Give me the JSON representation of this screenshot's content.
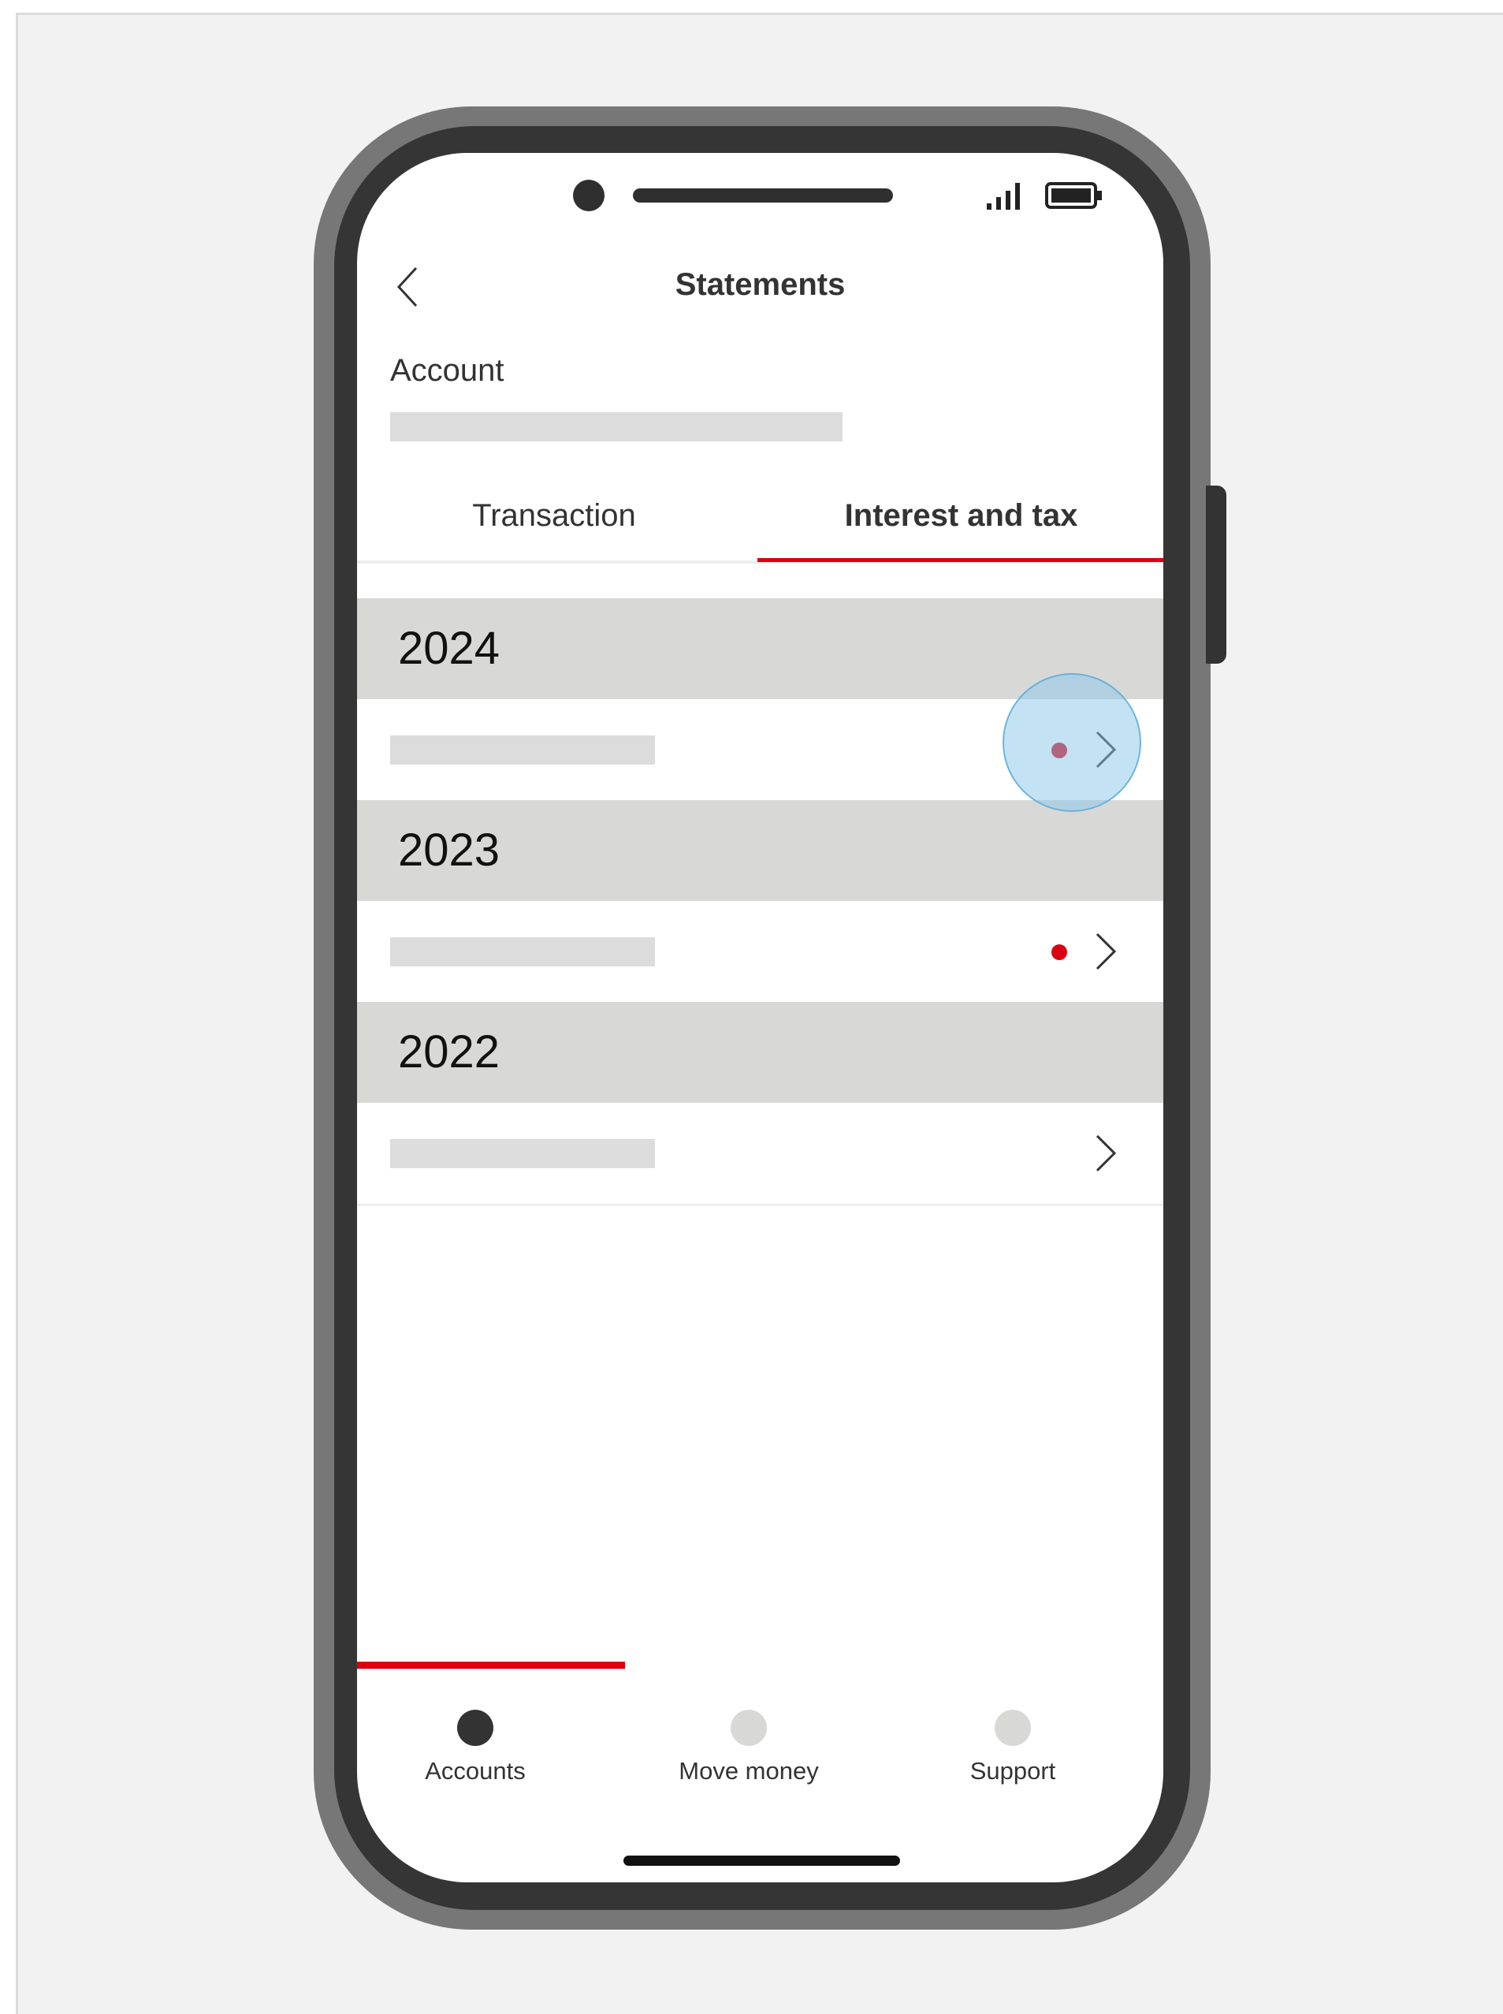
{
  "header": {
    "title": "Statements"
  },
  "account": {
    "label": "Account"
  },
  "tabs": [
    {
      "label": "Transaction",
      "selected": false
    },
    {
      "label": "Interest and tax",
      "selected": true
    }
  ],
  "years": [
    {
      "year": "2024",
      "has_new": true
    },
    {
      "year": "2023",
      "has_new": true
    },
    {
      "year": "2022",
      "has_new": false
    }
  ],
  "bottom_nav": [
    {
      "label": "Accounts",
      "active": true
    },
    {
      "label": "Move money",
      "active": false
    },
    {
      "label": "Support",
      "active": false
    }
  ],
  "colors": {
    "accent": "#db0011",
    "section_header_bg": "#d8d8d7",
    "placeholder": "#dcdcdc",
    "nav_active": "#333333",
    "nav_inactive": "#d8d8d7",
    "touch_indicator": "#87c8eb"
  },
  "icons": {
    "back": "chevron-left-icon",
    "row_action": "chevron-right-icon",
    "status": [
      "signal-icon",
      "battery-icon"
    ]
  }
}
